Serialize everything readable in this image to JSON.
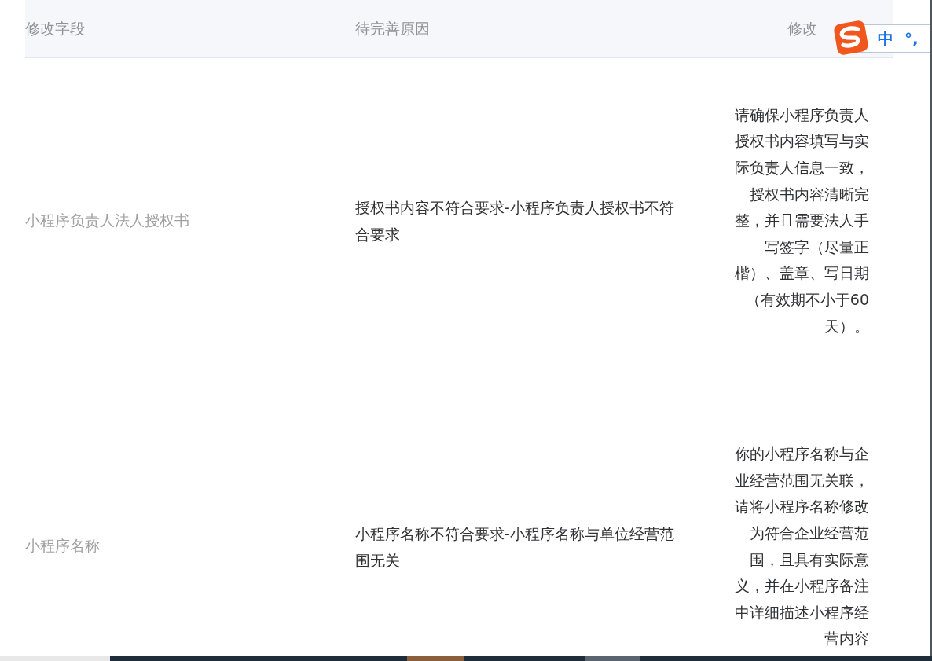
{
  "table": {
    "columns": [
      "修改字段",
      "待完善原因",
      "修改"
    ],
    "rows": [
      {
        "field": "小程序负责人法人授权书",
        "reason": "授权书内容不符合要求-小程序负责人授权书不符合要求",
        "suggestion": "请确保小程序负责人授权书内容填写与实际负责人信息一致，授权书内容清晰完整，并且需要法人手写签字（尽量正楷）、盖章、写日期（有效期不小于60天）。"
      },
      {
        "field": "小程序名称",
        "reason": "小程序名称不符合要求-小程序名称与单位经营范围无关",
        "suggestion": "你的小程序名称与企业经营范围无关联，请将小程序名称修改为符合企业经营范围，且具有实际意义，并在小程序备注中详细描述小程序经营内容"
      }
    ]
  },
  "ime_toolbar": {
    "mode": "中",
    "punctuation": "°,"
  }
}
